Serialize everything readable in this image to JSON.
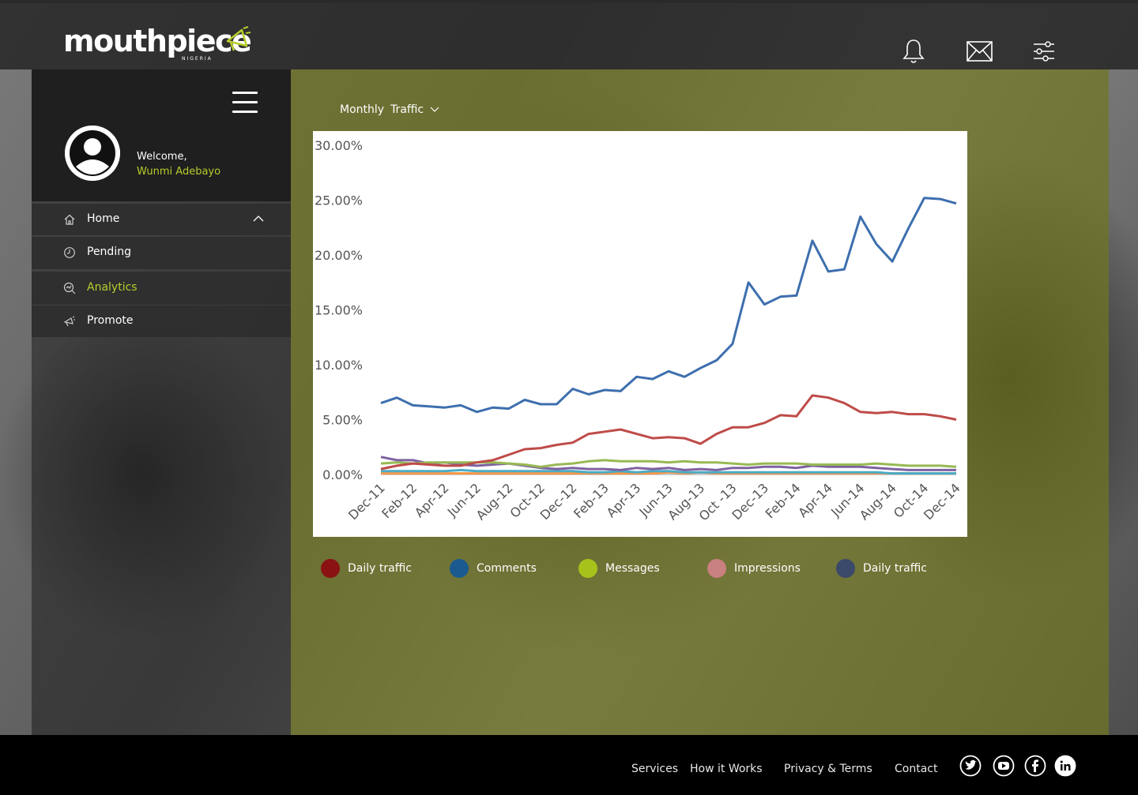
{
  "brand": {
    "name": "mouthpiece",
    "sub": "NIGERIA",
    "accent": "#b9cc2c"
  },
  "header": {
    "icons": [
      "bell-icon",
      "mail-icon",
      "settings-sliders-icon"
    ]
  },
  "sidebar": {
    "welcome": "Welcome,",
    "user_name": "Wunmi Adebayo",
    "items": [
      {
        "label": "Home",
        "icon": "home-icon",
        "active": false
      },
      {
        "label": "Pending",
        "icon": "clock-icon",
        "active": false
      },
      {
        "label": "Analytics",
        "icon": "analytics-icon",
        "active": true
      },
      {
        "label": "Promote",
        "icon": "megaphone-icon",
        "active": false
      }
    ]
  },
  "filter": {
    "period": "Monthly",
    "metric": "Traffic"
  },
  "chart_data": {
    "type": "line",
    "x": [
      "Dec-11",
      "Jan-12",
      "Feb-12",
      "Mar-12",
      "Apr-12",
      "May-12",
      "Jun-12",
      "Jul-12",
      "Aug-12",
      "Sep-12",
      "Oct-12",
      "Nov-12",
      "Dec-12",
      "Jan-13",
      "Feb-13",
      "Mar-13",
      "Apr-13",
      "May-13",
      "Jun-13",
      "Jul-13",
      "Aug-13",
      "Sep-13",
      "Oct-13",
      "Nov-13",
      "Dec-13",
      "Jan-14",
      "Feb-14",
      "Mar-14",
      "Apr-14",
      "May-14",
      "Jun-14",
      "Jul-14",
      "Aug-14",
      "Sep-14",
      "Oct-14",
      "Nov-14",
      "Dec-14"
    ],
    "tick_labels": [
      "Dec-11",
      "Feb-12",
      "Apr-12",
      "Jun-12",
      "Aug-12",
      "Oct-12",
      "Dec-12",
      "Feb-13",
      "Apr-13",
      "Jun-13",
      "Aug-13",
      "Oct -13",
      "Dec-13",
      "Feb-14",
      "Apr-14",
      "Jun-14",
      "Aug-14",
      "Oct-14",
      "Dec-14"
    ],
    "y_ticks": [
      "30.00%",
      "25.00%",
      "20.00%",
      "15.00%",
      "10.00%",
      "5.00%",
      "0.00%"
    ],
    "ylim": [
      0,
      30
    ],
    "series": [
      {
        "color": "#3d6fae",
        "values": [
          6.5,
          7.0,
          6.3,
          6.2,
          6.1,
          6.3,
          5.7,
          6.1,
          6.0,
          6.8,
          6.4,
          6.4,
          7.8,
          7.3,
          7.7,
          7.6,
          8.9,
          8.7,
          9.4,
          8.9,
          9.7,
          10.4,
          11.9,
          17.5,
          15.5,
          16.2,
          16.3,
          21.3,
          18.5,
          18.7,
          23.5,
          21.0,
          19.4,
          22.4,
          25.2,
          25.1,
          24.7
        ]
      },
      {
        "color": "#be4b48",
        "values": [
          0.5,
          0.8,
          1.0,
          0.9,
          0.8,
          0.8,
          1.1,
          1.3,
          1.8,
          2.3,
          2.4,
          2.7,
          2.9,
          3.7,
          3.9,
          4.1,
          3.7,
          3.3,
          3.4,
          3.3,
          2.8,
          3.7,
          4.3,
          4.3,
          4.7,
          5.4,
          5.3,
          7.2,
          7.0,
          6.5,
          5.7,
          5.6,
          5.7,
          5.5,
          5.5,
          5.3,
          5.0
        ]
      },
      {
        "color": "#98b954",
        "values": [
          1.0,
          1.1,
          1.0,
          1.1,
          1.1,
          1.1,
          1.1,
          1.1,
          1.0,
          0.9,
          0.7,
          0.9,
          1.0,
          1.2,
          1.3,
          1.2,
          1.2,
          1.2,
          1.1,
          1.2,
          1.1,
          1.1,
          1.0,
          0.9,
          1.0,
          1.0,
          1.0,
          0.9,
          0.9,
          0.9,
          0.9,
          1.0,
          0.9,
          0.8,
          0.8,
          0.8,
          0.7
        ]
      },
      {
        "color": "#7e62a1",
        "values": [
          1.6,
          1.3,
          1.3,
          1.0,
          1.1,
          0.9,
          0.8,
          0.9,
          1.0,
          0.8,
          0.6,
          0.5,
          0.6,
          0.5,
          0.5,
          0.4,
          0.6,
          0.5,
          0.6,
          0.4,
          0.5,
          0.4,
          0.6,
          0.6,
          0.7,
          0.7,
          0.6,
          0.8,
          0.7,
          0.7,
          0.7,
          0.6,
          0.5,
          0.4,
          0.4,
          0.4,
          0.4
        ]
      },
      {
        "color": "#4bacc6",
        "values": [
          0.3,
          0.3,
          0.3,
          0.3,
          0.3,
          0.4,
          0.3,
          0.3,
          0.3,
          0.3,
          0.3,
          0.3,
          0.3,
          0.2,
          0.2,
          0.3,
          0.2,
          0.3,
          0.3,
          0.2,
          0.2,
          0.2,
          0.2,
          0.2,
          0.2,
          0.2,
          0.2,
          0.2,
          0.2,
          0.2,
          0.2,
          0.2,
          0.1,
          0.1,
          0.1,
          0.1,
          0.1
        ]
      },
      {
        "color": "#f79646",
        "values": [
          0.1,
          0.1,
          0.1,
          0.1,
          0.1,
          0.1,
          0.1,
          0.1,
          0.1,
          0.1,
          0.1,
          0.1,
          0.1,
          0.1,
          0.1,
          0.1,
          0.1,
          0.1,
          0.2,
          0.1,
          0.2,
          0.1,
          0.1,
          0.1,
          0.1,
          0.1,
          0.1,
          0.1,
          0.1,
          0.1,
          0.1,
          0.1,
          0.1,
          0.1,
          0.1,
          0.1,
          0.1
        ]
      }
    ],
    "grid": false
  },
  "legend": [
    {
      "label": "Daily traffic",
      "color": "#8a1212"
    },
    {
      "label": "Comments",
      "color": "#1b5a8f"
    },
    {
      "label": "Messages",
      "color": "#a8c21c"
    },
    {
      "label": "Impressions",
      "color": "#c98080"
    },
    {
      "label": "Daily traffic",
      "color": "#3b4a6a"
    }
  ],
  "footer": {
    "links": [
      "Services",
      "How it Works",
      "Privacy & Terms",
      "Contact"
    ],
    "social": [
      "twitter-icon",
      "youtube-icon",
      "facebook-icon",
      "linkedin-icon"
    ]
  }
}
